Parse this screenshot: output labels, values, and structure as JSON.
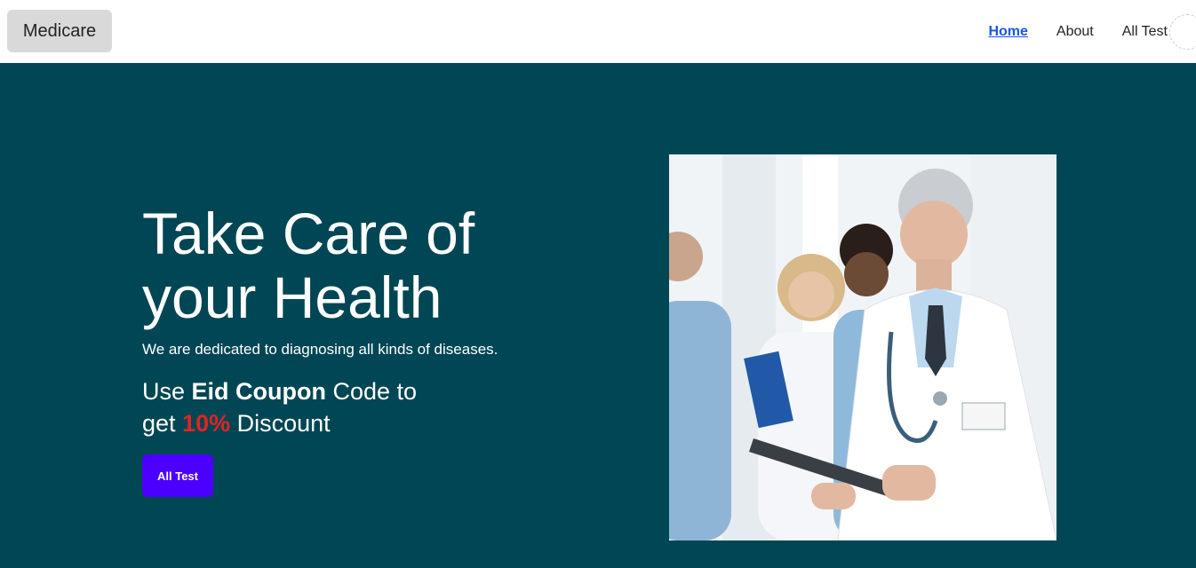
{
  "navbar": {
    "brand": "Medicare",
    "links": [
      {
        "label": "Home",
        "active": true
      },
      {
        "label": "About",
        "active": false
      },
      {
        "label": "All Test",
        "active": false
      }
    ]
  },
  "hero": {
    "title_line1": "Take Care of",
    "title_line2": "your Health",
    "subtitle": "We are dedicated to diagnosing all kinds of diseases.",
    "coupon": {
      "part1": "Use ",
      "highlight": "Eid Coupon",
      "part2": " Code to",
      "part3": "get ",
      "percent": "10%",
      "part4": " Discount"
    },
    "cta_label": "All Test"
  },
  "colors": {
    "hero_bg": "#004654",
    "accent": "#4b00ff",
    "discount": "#e02424",
    "active_link": "#1a56e8"
  }
}
